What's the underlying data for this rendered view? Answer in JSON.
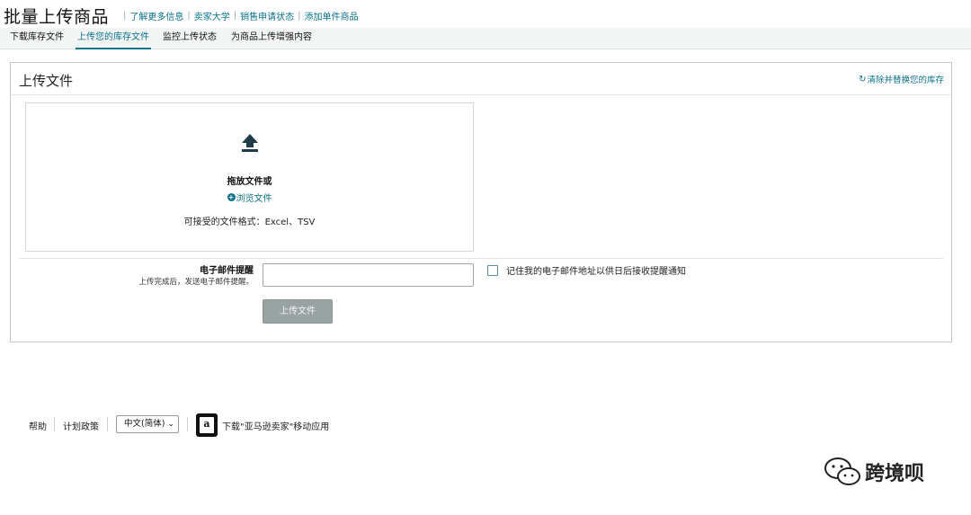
{
  "header": {
    "title": "批量上传商品",
    "links": [
      "了解更多信息",
      "卖家大学",
      "销售申请状态",
      "添加单件商品"
    ]
  },
  "tabs": [
    {
      "label": "下载库存文件",
      "active": false
    },
    {
      "label": "上传您的库存文件",
      "active": true
    },
    {
      "label": "监控上传状态",
      "active": false
    },
    {
      "label": "为商品上传增强内容",
      "active": false
    }
  ],
  "upload_card": {
    "title": "上传文件",
    "replace_link": "清除并替换您的库存",
    "dropzone": {
      "drop_text": "拖放文件或",
      "browse_text": "浏览文件",
      "formats": "可接受的文件格式：Excel、TSV"
    },
    "email": {
      "label": "电子邮件提醒",
      "help": "上传完成后，发送电子邮件提醒。",
      "value": "",
      "remember_label": "记住我的电子邮件地址以供日后接收提醒通知",
      "remember_checked": false
    },
    "upload_button": "上传文件"
  },
  "footer": {
    "help": "帮助",
    "policy": "计划政策",
    "language": "中文(简体)",
    "app_text": "下载\"亚马逊卖家\"移动应用"
  },
  "watermark": "跨境呗",
  "colors": {
    "link": "#0a7289",
    "button_disabled": "#9aa3a3",
    "tab_bar": "#f3f5f5"
  },
  "icons": [
    "upload-arrow-icon",
    "refresh-icon",
    "plus-circle-icon",
    "checkbox-icon",
    "amazon-app-icon",
    "wechat-icon"
  ]
}
